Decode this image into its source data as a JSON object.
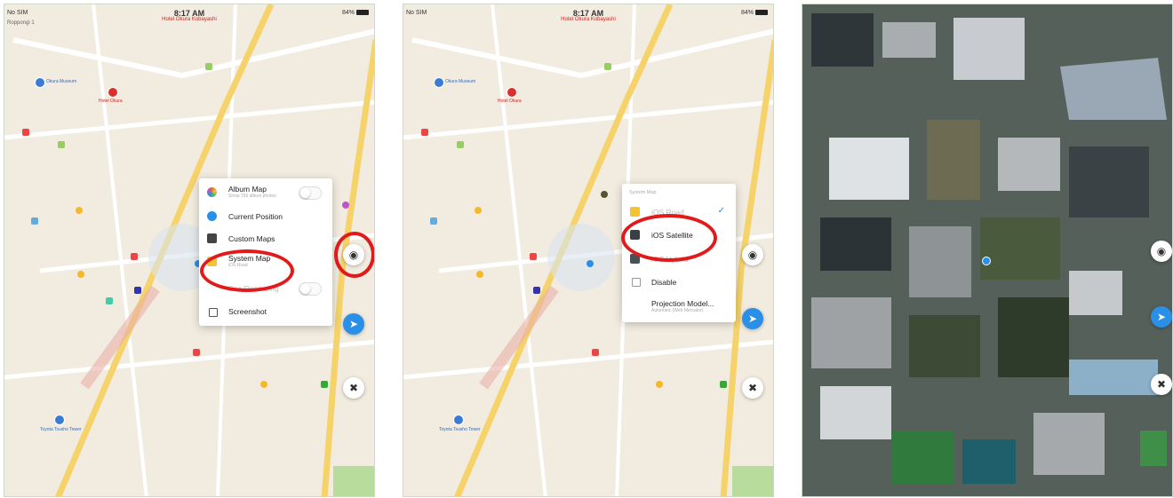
{
  "status_bar": {
    "carrier": "No SIM",
    "time": "8:17 AM",
    "battery": "84%"
  },
  "map": {
    "top_label": "Hotel Okura Kobayashi",
    "sub_label": "Roppongi 1",
    "poi_labels": {
      "hotel": "Hotel Okura",
      "museum": "Okura Museum",
      "station": "Toyota Tsusho Tower"
    }
  },
  "panel1": {
    "menu": {
      "items": [
        {
          "title": "Album Map",
          "subtitle": "Show 156 album photos",
          "icon_color": "#e86a3a",
          "toggle": true
        },
        {
          "title": "Current Position",
          "subtitle": "",
          "icon_color": "#2a8fe6",
          "toggle": false
        },
        {
          "title": "Custom Maps",
          "subtitle": "",
          "icon_color": "#444444",
          "toggle": false
        },
        {
          "title": "System Map",
          "subtitle": "iOS Road",
          "icon_color": "#f4c430",
          "toggle": false
        },
        {
          "title": "Sea Rendering",
          "subtitle": "",
          "icon_color": "#ffffff",
          "toggle": true
        },
        {
          "title": "Screenshot",
          "subtitle": "",
          "icon_color": "#555555",
          "toggle": false
        }
      ]
    }
  },
  "panel2": {
    "menu": {
      "header": "System Map",
      "items": [
        {
          "title": "iOS Road",
          "subtitle": "",
          "icon_color": "#f4c430",
          "checked": true
        },
        {
          "title": "iOS Satellite",
          "subtitle": "",
          "icon_color": "#3a3f44",
          "checked": false
        },
        {
          "title": "iOS Hybrid",
          "subtitle": "",
          "icon_color": "#4a4f54",
          "checked": false
        },
        {
          "title": "Disable",
          "subtitle": "",
          "icon_color": "#888888",
          "checked": false
        },
        {
          "title": "Projection Model...",
          "subtitle": "Automatic (Web Mercator)",
          "icon_color": "#ffffff",
          "checked": false
        }
      ]
    }
  },
  "controls": {
    "eye_icon": "eye-icon",
    "location_icon": "location-arrow-icon",
    "tools_icon": "tools-icon"
  },
  "colors": {
    "highlight_red": "#e11b1b",
    "accent_blue": "#2a8fe6",
    "road_yellow": "#f6d36a",
    "map_bg": "#f2ece0"
  }
}
